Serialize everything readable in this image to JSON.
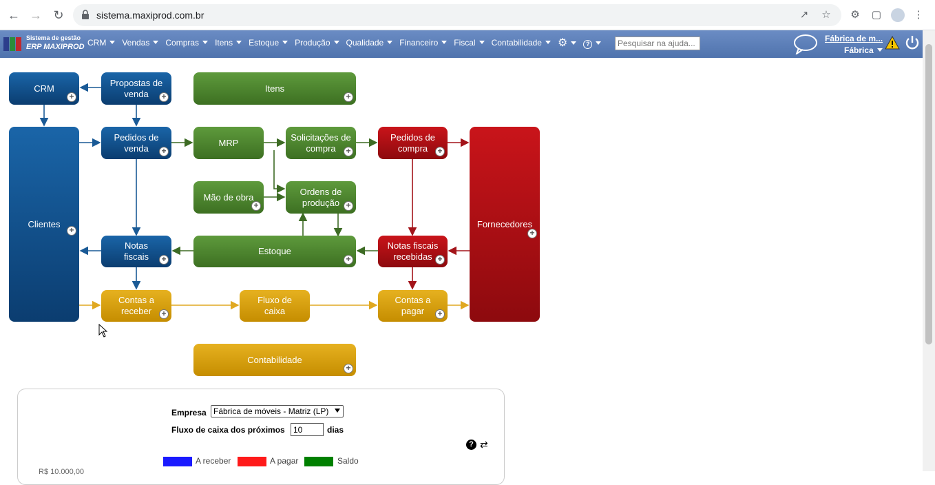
{
  "browser": {
    "url": "sistema.maxiprod.com.br"
  },
  "app": {
    "logo_line1": "Sistema de gestão",
    "logo_line2": "ERP MAXIPROD",
    "menu": [
      "CRM",
      "Vendas",
      "Compras",
      "Itens",
      "Estoque",
      "Produção",
      "Qualidade",
      "Financeiro",
      "Fiscal",
      "Contabilidade"
    ],
    "help_placeholder": "Pesquisar na ajuda...",
    "company_name": "Fábrica de m...",
    "company_sub": "Fábrica"
  },
  "flow": {
    "crm": "CRM",
    "propostas": "Propostas de venda",
    "itens": "Itens",
    "clientes": "Clientes",
    "pedidos_venda": "Pedidos de venda",
    "mrp": "MRP",
    "solicitacoes": "Solicitações de compra",
    "pedidos_compra": "Pedidos de compra",
    "fornecedores": "Fornecedores",
    "mao_obra": "Mão de obra",
    "ordens": "Ordens de produção",
    "notas_fiscais": "Notas fiscais",
    "estoque": "Estoque",
    "notas_recebidas": "Notas fiscais recebidas",
    "contas_receber": "Contas a receber",
    "fluxo_caixa": "Fluxo de caixa",
    "contas_pagar": "Contas a pagar",
    "contabilidade": "Contabilidade"
  },
  "panel": {
    "empresa_label": "Empresa",
    "empresa_value": "Fábrica de móveis - Matriz (LP)",
    "fluxo_label": "Fluxo de caixa dos próximos",
    "dias_value": "10",
    "dias_label": "dias",
    "legend": [
      {
        "label": "A receber",
        "color": "#1a1aff"
      },
      {
        "label": "A pagar",
        "color": "#ff1a1a"
      },
      {
        "label": "Saldo",
        "color": "#008000"
      }
    ],
    "axis_partial": "R$ 10.000,00"
  }
}
